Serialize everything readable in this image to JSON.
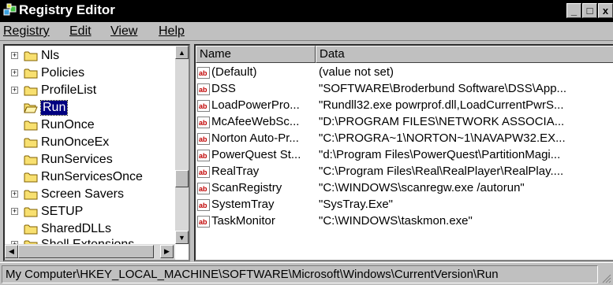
{
  "window": {
    "title": "Registry Editor",
    "buttons": {
      "minimize": "_",
      "maximize": "□",
      "close": "x"
    }
  },
  "menu": [
    {
      "label": "Registry"
    },
    {
      "label": "Edit"
    },
    {
      "label": "View"
    },
    {
      "label": "Help"
    }
  ],
  "tree": {
    "items": [
      {
        "label": "Nls",
        "expander": "+",
        "selected": false
      },
      {
        "label": "Policies",
        "expander": "+",
        "selected": false
      },
      {
        "label": "ProfileList",
        "expander": "+",
        "selected": false
      },
      {
        "label": "Run",
        "expander": "",
        "selected": true
      },
      {
        "label": "RunOnce",
        "expander": "",
        "selected": false
      },
      {
        "label": "RunOnceEx",
        "expander": "",
        "selected": false
      },
      {
        "label": "RunServices",
        "expander": "",
        "selected": false
      },
      {
        "label": "RunServicesOnce",
        "expander": "",
        "selected": false
      },
      {
        "label": "Screen Savers",
        "expander": "+",
        "selected": false
      },
      {
        "label": "SETUP",
        "expander": "+",
        "selected": false
      },
      {
        "label": "SharedDLLs",
        "expander": "",
        "selected": false
      },
      {
        "label": "Shell Extensions",
        "expander": "+",
        "selected": false
      }
    ]
  },
  "list": {
    "columns": {
      "name": "Name",
      "data": "Data"
    },
    "rows": [
      {
        "name": "(Default)",
        "data": "(value not set)"
      },
      {
        "name": "DSS",
        "data": "\"SOFTWARE\\Broderbund Software\\DSS\\App..."
      },
      {
        "name": "LoadPowerPro...",
        "data": "\"Rundll32.exe powrprof.dll,LoadCurrentPwrS..."
      },
      {
        "name": "McAfeeWebSc...",
        "data": "\"D:\\PROGRAM FILES\\NETWORK ASSOCIA..."
      },
      {
        "name": "Norton Auto-Pr...",
        "data": "\"C:\\PROGRA~1\\NORTON~1\\NAVAPW32.EX..."
      },
      {
        "name": "PowerQuest St...",
        "data": "\"d:\\Program Files\\PowerQuest\\PartitionMagi..."
      },
      {
        "name": "RealTray",
        "data": "\"C:\\Program Files\\Real\\RealPlayer\\RealPlay...."
      },
      {
        "name": "ScanRegistry",
        "data": "\"C:\\WINDOWS\\scanregw.exe /autorun\""
      },
      {
        "name": "SystemTray",
        "data": "\"SysTray.Exe\""
      },
      {
        "name": "TaskMonitor",
        "data": "\"C:\\WINDOWS\\taskmon.exe\""
      }
    ]
  },
  "status": {
    "path": "My Computer\\HKEY_LOCAL_MACHINE\\SOFTWARE\\Microsoft\\Windows\\CurrentVersion\\Run"
  },
  "icons": {
    "app": "registry-editor-icon",
    "tree_item": "folder-icon",
    "selected_item": "open-folder-icon",
    "value": "string-value-icon"
  },
  "colors": {
    "title_bar": "#000000",
    "selection": "#000080",
    "chrome": "#c0c0c0",
    "folder": "#f8e070",
    "value_icon": "#c00000"
  }
}
